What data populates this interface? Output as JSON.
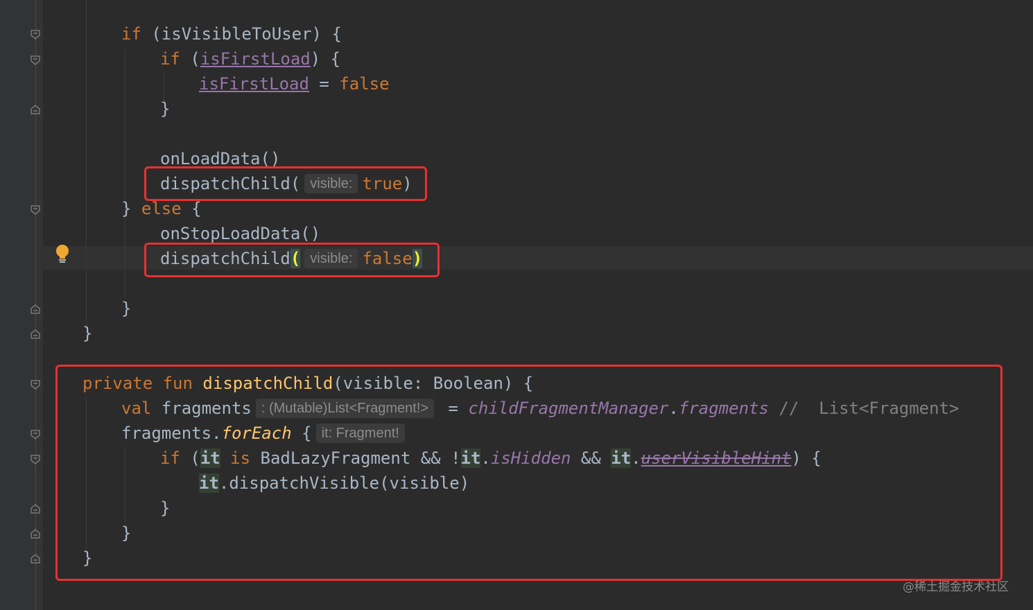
{
  "code": {
    "l1": {
      "kw": "if",
      "rest": " (isVisibleToUser) {"
    },
    "l2": {
      "kw": "if",
      "open": " (",
      "prop": "isFirstLoad",
      "close": ") {"
    },
    "l3": {
      "prop": "isFirstLoad",
      "mid": " = ",
      "kw": "false"
    },
    "l4": {
      "text": "}"
    },
    "l5": {
      "text": "onLoadData()"
    },
    "l6": {
      "fn": "dispatchChild(",
      "hint": "visible:",
      "kw": "true",
      "close": ")"
    },
    "l7": {
      "close": "} ",
      "kw": "else",
      "rest": " {"
    },
    "l8": {
      "text": "onStopLoadData()"
    },
    "l9": {
      "fn": "dispatchChild",
      "paren_open": "(",
      "hint": "visible:",
      "kw": "false",
      "paren_close": ")"
    },
    "l10": {
      "text": "}"
    },
    "l11": {
      "text": "}"
    },
    "l12": {
      "kw1": "private",
      "kw2": "fun",
      "fn": "dispatchChild",
      "rest": "(visible: Boolean) {"
    },
    "l13": {
      "kw": "val",
      "name": " fragments",
      "hint": ": (Mutable)List<Fragment!>",
      "eq": " = ",
      "obj": "childFragmentManager",
      "dot": ".",
      "field": "fragments",
      "comment": " //  List<Fragment>"
    },
    "l14": {
      "name": "fragments.",
      "fn": "forEach",
      "brace": " {",
      "hint": "it: Fragment!"
    },
    "l15": {
      "kw": "if",
      "p1": " (",
      "it1": "it",
      "is": " is",
      "type": " BadLazyFragment && !",
      "it2": "it",
      "dot1": ".",
      "hidden": "isHidden",
      "and": " && ",
      "it3": "it",
      "dot2": ".",
      "deprecated": "userVisibleHint",
      "end": ") {"
    },
    "l16": {
      "it": "it",
      "rest": ".dispatchVisible(visible)"
    },
    "l17": {
      "text": "}"
    },
    "l18": {
      "text": "}"
    },
    "l19": {
      "text": "}"
    }
  },
  "watermark": "@稀土掘金技术社区",
  "icons": {
    "bulb": "lightbulb-icon",
    "fold": "fold-marker-icon"
  },
  "colors": {
    "keyword": "#cc7832",
    "function": "#ffc66d",
    "property": "#9876aa",
    "text": "#a9b7c6",
    "highlight_box": "#e8312f",
    "background": "#2b2b2b"
  }
}
